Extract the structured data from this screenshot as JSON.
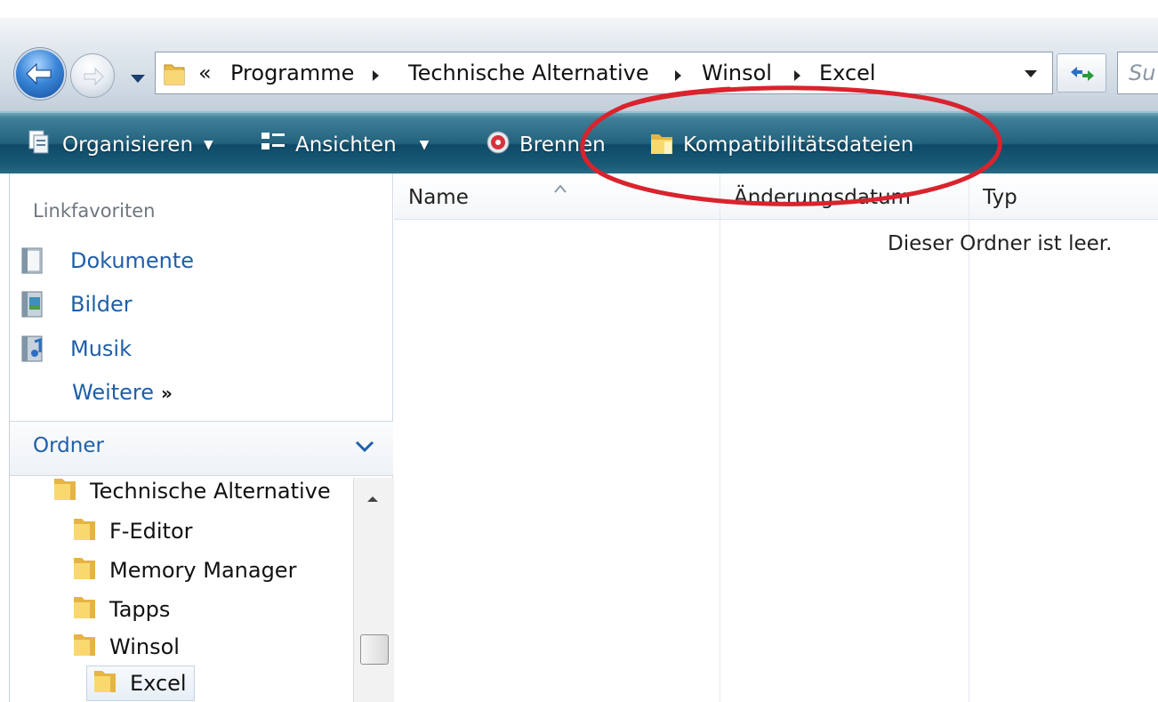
{
  "breadcrumb": {
    "overflow": "«",
    "items": [
      "Programme",
      "Technische Alternative",
      "Winsol",
      "Excel"
    ]
  },
  "search": {
    "placeholder": "Su"
  },
  "commandbar": {
    "organize": "Organisieren",
    "views": "Ansichten",
    "burn": "Brennen",
    "compat": "Kompatibilitätsdateien"
  },
  "navpane": {
    "favorites_heading": "Linkfavoriten",
    "favorites": [
      "Dokumente",
      "Bilder",
      "Musik"
    ],
    "more": "Weitere",
    "folders_heading": "Ordner",
    "tree": [
      "Technische Alternative",
      "F-Editor",
      "Memory Manager",
      "Tapps",
      "Winsol",
      "Excel"
    ]
  },
  "filelist": {
    "columns": [
      "Name",
      "Änderungsdatum",
      "Typ"
    ],
    "empty_message": "Dieser Ordner ist leer."
  },
  "colors": {
    "command_bar": "#1a5c79",
    "link_blue": "#1f5fa8",
    "annotation_red": "#d9232d"
  }
}
